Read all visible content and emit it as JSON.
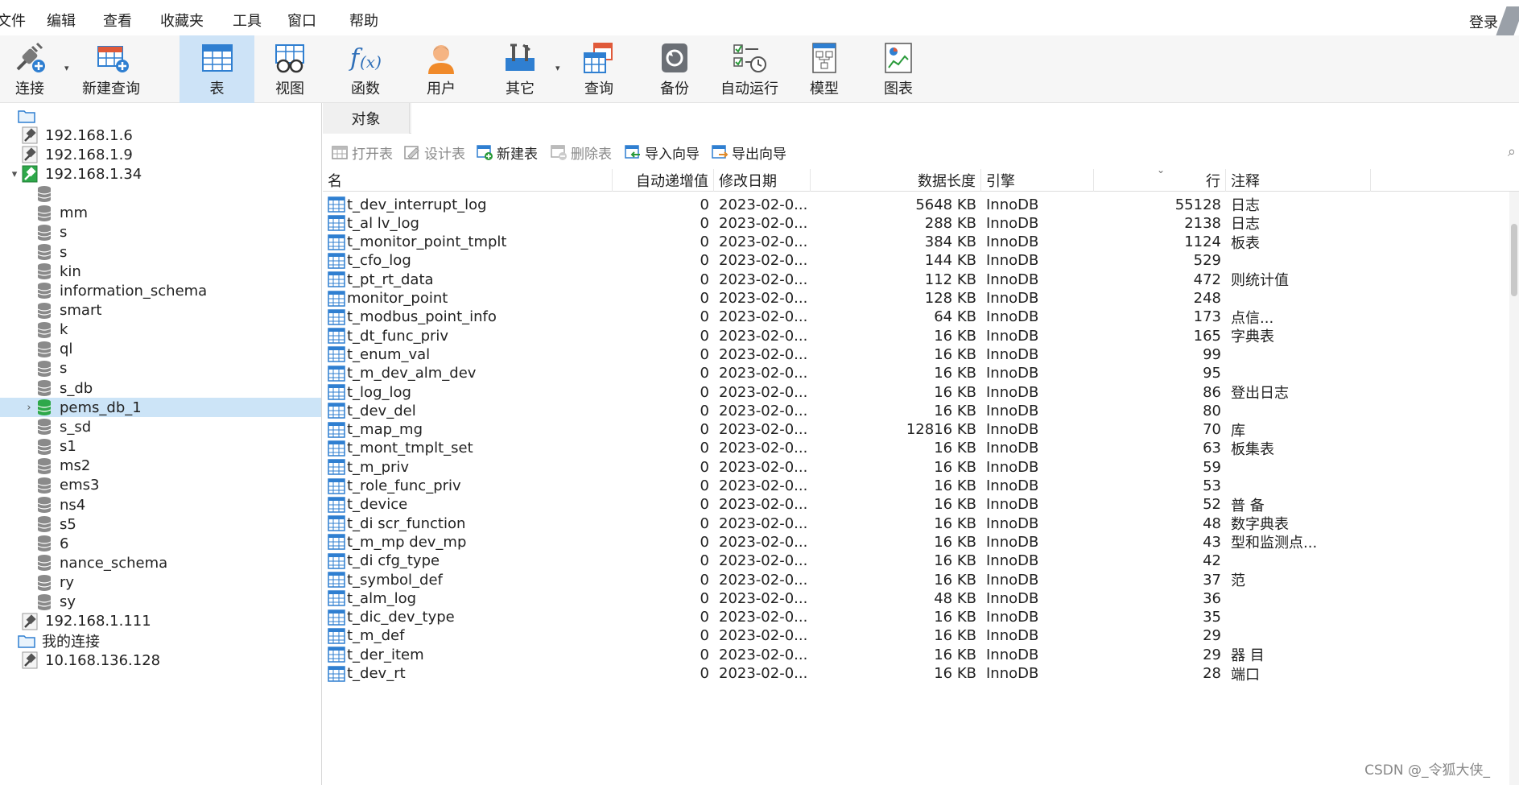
{
  "menu": [
    "文件",
    "编辑",
    "查看",
    "收藏夹",
    "工具",
    "窗口",
    "帮助"
  ],
  "login_label": "登录",
  "toolbar": {
    "connect": "连接",
    "new_query": "新建查询",
    "table": "表",
    "view": "视图",
    "function": "函数",
    "user": "用户",
    "other": "其它",
    "query": "查询",
    "backup": "备份",
    "auto_run": "自动运行",
    "model": "模型",
    "chart": "图表"
  },
  "tree": [
    {
      "label": "",
      "type": "folder",
      "indent": 0
    },
    {
      "label": "192.168.1.6",
      "type": "conn",
      "indent": 1
    },
    {
      "label": "192.168.1.9",
      "type": "conn",
      "indent": 1
    },
    {
      "label": "192.168.1.34",
      "type": "conn-open",
      "indent": 1,
      "arrow": "▾"
    },
    {
      "label": "",
      "type": "db",
      "indent": 2
    },
    {
      "label": "mm",
      "type": "db",
      "indent": 2
    },
    {
      "label": "s",
      "type": "db",
      "indent": 2
    },
    {
      "label": "s",
      "type": "db",
      "indent": 2
    },
    {
      "label": "kin",
      "type": "db",
      "indent": 2
    },
    {
      "label": "information_schema",
      "type": "db",
      "indent": 2
    },
    {
      "label": "smart",
      "type": "db",
      "indent": 2
    },
    {
      "label": "k",
      "type": "db",
      "indent": 2
    },
    {
      "label": "ql",
      "type": "db",
      "indent": 2
    },
    {
      "label": "s",
      "type": "db",
      "indent": 2
    },
    {
      "label": "s_db",
      "type": "db",
      "indent": 2
    },
    {
      "label": "pems_db_1",
      "type": "db-open",
      "indent": 2,
      "arrow": "›",
      "selected": true
    },
    {
      "label": "s_sd",
      "type": "db",
      "indent": 2
    },
    {
      "label": "s1",
      "type": "db",
      "indent": 2
    },
    {
      "label": "ms2",
      "type": "db",
      "indent": 2
    },
    {
      "label": "ems3",
      "type": "db",
      "indent": 2
    },
    {
      "label": "ns4",
      "type": "db",
      "indent": 2
    },
    {
      "label": "s5",
      "type": "db",
      "indent": 2
    },
    {
      "label": "6",
      "type": "db",
      "indent": 2
    },
    {
      "label": "nance_schema",
      "type": "db",
      "indent": 2
    },
    {
      "label": "ry",
      "type": "db",
      "indent": 2
    },
    {
      "label": "sy",
      "type": "db",
      "indent": 2
    },
    {
      "label": "192.168.1.111",
      "type": "conn",
      "indent": 1
    },
    {
      "label": "我的连接",
      "type": "folder",
      "indent": 0
    },
    {
      "label": "10.168.136.128",
      "type": "conn",
      "indent": 1
    }
  ],
  "tabs": {
    "objects": "对象"
  },
  "object_toolbar": {
    "open_table": "打开表",
    "design_table": "设计表",
    "new_table": "新建表",
    "delete_table": "删除表",
    "import_wizard": "导入向导",
    "export_wizard": "导出向导"
  },
  "columns": {
    "name": "名",
    "auto_inc": "自动递增值",
    "modified": "修改日期",
    "data_length": "数据长度",
    "engine": "引擎",
    "rows": "行",
    "comment": "注释"
  },
  "rows": [
    {
      "name": "t_dev_interrupt_log",
      "auto": "0",
      "date": "2023-02-0...",
      "len": "5648 KB",
      "engine": "InnoDB",
      "rows": "55128",
      "comment": "日志"
    },
    {
      "name": "t_al lv_log",
      "auto": "0",
      "date": "2023-02-0...",
      "len": "288 KB",
      "engine": "InnoDB",
      "rows": "2138",
      "comment": "日志"
    },
    {
      "name": "t_monitor_point_tmplt",
      "auto": "0",
      "date": "2023-02-0...",
      "len": "384 KB",
      "engine": "InnoDB",
      "rows": "1124",
      "comment": "板表"
    },
    {
      "name": "t_cfo_log",
      "auto": "0",
      "date": "2023-02-0...",
      "len": "144 KB",
      "engine": "InnoDB",
      "rows": "529",
      "comment": ""
    },
    {
      "name": "t_pt_rt_data",
      "auto": "0",
      "date": "2023-02-0...",
      "len": "112 KB",
      "engine": "InnoDB",
      "rows": "472",
      "comment": "则统计值"
    },
    {
      "name": "monitor_point",
      "auto": "0",
      "date": "2023-02-0...",
      "len": "128 KB",
      "engine": "InnoDB",
      "rows": "248",
      "comment": ""
    },
    {
      "name": "t_modbus_point_info",
      "auto": "0",
      "date": "2023-02-0...",
      "len": "64 KB",
      "engine": "InnoDB",
      "rows": "173",
      "comment": "点信..."
    },
    {
      "name": "t_dt_func_priv",
      "auto": "0",
      "date": "2023-02-0...",
      "len": "16 KB",
      "engine": "InnoDB",
      "rows": "165",
      "comment": "字典表"
    },
    {
      "name": "t_enum_val",
      "auto": "0",
      "date": "2023-02-0...",
      "len": "16 KB",
      "engine": "InnoDB",
      "rows": "99",
      "comment": ""
    },
    {
      "name": "t_m_dev_alm_dev",
      "auto": "0",
      "date": "2023-02-0...",
      "len": "16 KB",
      "engine": "InnoDB",
      "rows": "95",
      "comment": ""
    },
    {
      "name": "t_log_log",
      "auto": "0",
      "date": "2023-02-0...",
      "len": "16 KB",
      "engine": "InnoDB",
      "rows": "86",
      "comment": "登出日志"
    },
    {
      "name": "t_dev_del",
      "auto": "0",
      "date": "2023-02-0...",
      "len": "16 KB",
      "engine": "InnoDB",
      "rows": "80",
      "comment": ""
    },
    {
      "name": "t_map_mg",
      "auto": "0",
      "date": "2023-02-0...",
      "len": "12816 KB",
      "engine": "InnoDB",
      "rows": "70",
      "comment": "库"
    },
    {
      "name": "t_mont_tmplt_set",
      "auto": "0",
      "date": "2023-02-0...",
      "len": "16 KB",
      "engine": "InnoDB",
      "rows": "63",
      "comment": "板集表"
    },
    {
      "name": "t_m_priv",
      "auto": "0",
      "date": "2023-02-0...",
      "len": "16 KB",
      "engine": "InnoDB",
      "rows": "59",
      "comment": ""
    },
    {
      "name": "t_role_func_priv",
      "auto": "0",
      "date": "2023-02-0...",
      "len": "16 KB",
      "engine": "InnoDB",
      "rows": "53",
      "comment": ""
    },
    {
      "name": "t_device",
      "auto": "0",
      "date": "2023-02-0...",
      "len": "16 KB",
      "engine": "InnoDB",
      "rows": "52",
      "comment": "普 备"
    },
    {
      "name": "t_di scr_function",
      "auto": "0",
      "date": "2023-02-0...",
      "len": "16 KB",
      "engine": "InnoDB",
      "rows": "48",
      "comment": "数字典表"
    },
    {
      "name": "t_m_mp dev_mp",
      "auto": "0",
      "date": "2023-02-0...",
      "len": "16 KB",
      "engine": "InnoDB",
      "rows": "43",
      "comment": "型和监测点..."
    },
    {
      "name": "t_di cfg_type",
      "auto": "0",
      "date": "2023-02-0...",
      "len": "16 KB",
      "engine": "InnoDB",
      "rows": "42",
      "comment": ""
    },
    {
      "name": "t_symbol_def",
      "auto": "0",
      "date": "2023-02-0...",
      "len": "16 KB",
      "engine": "InnoDB",
      "rows": "37",
      "comment": "范"
    },
    {
      "name": "t_alm_log",
      "auto": "0",
      "date": "2023-02-0...",
      "len": "48 KB",
      "engine": "InnoDB",
      "rows": "36",
      "comment": ""
    },
    {
      "name": "t_dic_dev_type",
      "auto": "0",
      "date": "2023-02-0...",
      "len": "16 KB",
      "engine": "InnoDB",
      "rows": "35",
      "comment": ""
    },
    {
      "name": "t_m_def",
      "auto": "0",
      "date": "2023-02-0...",
      "len": "16 KB",
      "engine": "InnoDB",
      "rows": "29",
      "comment": ""
    },
    {
      "name": "t_der_item",
      "auto": "0",
      "date": "2023-02-0...",
      "len": "16 KB",
      "engine": "InnoDB",
      "rows": "29",
      "comment": "器 目"
    },
    {
      "name": "t_dev_rt",
      "auto": "0",
      "date": "2023-02-0...",
      "len": "16 KB",
      "engine": "InnoDB",
      "rows": "28",
      "comment": "端口"
    }
  ],
  "watermark": "CSDN @_令狐大侠_"
}
